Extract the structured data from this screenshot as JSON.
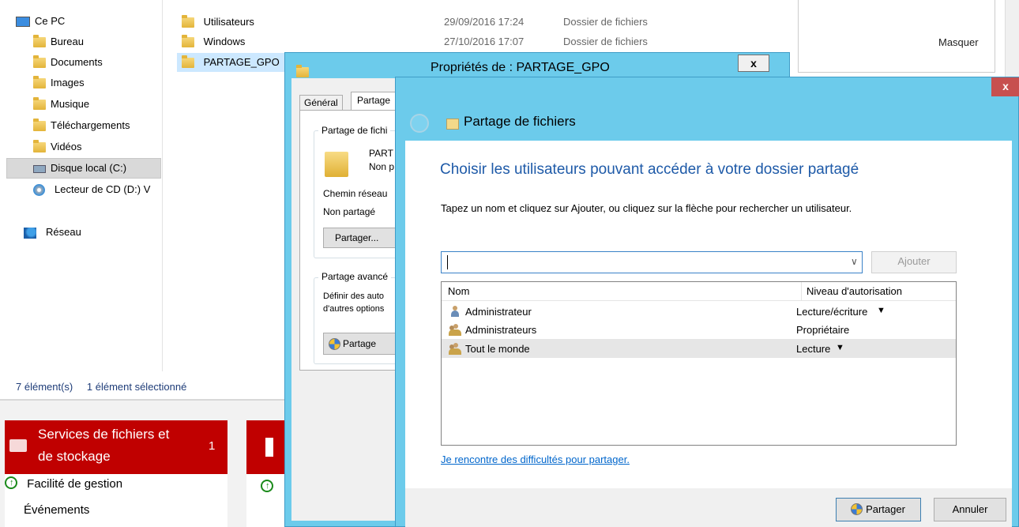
{
  "explorer": {
    "nav": [
      {
        "label": "Ce PC",
        "icon": "computer-icon"
      },
      {
        "label": "Bureau",
        "icon": "folder-icon"
      },
      {
        "label": "Documents",
        "icon": "folder-icon"
      },
      {
        "label": "Images",
        "icon": "folder-icon"
      },
      {
        "label": "Musique",
        "icon": "folder-icon"
      },
      {
        "label": "Téléchargements",
        "icon": "folder-icon"
      },
      {
        "label": "Vidéos",
        "icon": "folder-icon"
      },
      {
        "label": "Disque local (C:)",
        "icon": "drive-icon"
      },
      {
        "label": "Lecteur de CD (D:) V",
        "icon": "cd-drive-icon"
      },
      {
        "label": "Réseau",
        "icon": "network-icon"
      }
    ],
    "files": [
      {
        "name": "Utilisateurs",
        "date": "29/09/2016 17:24",
        "type": "Dossier de fichiers"
      },
      {
        "name": "Windows",
        "date": "27/10/2016 17:07",
        "type": "Dossier de fichiers"
      },
      {
        "name": "PARTAGE_GPO",
        "date": "",
        "type": ""
      }
    ],
    "status_count": "7 élément(s)",
    "status_selected": "1 élément sélectionné",
    "hide_label": "Masquer"
  },
  "server_manager": {
    "tile_title_line1": "Services de fichiers et",
    "tile_title_line2": "de stockage",
    "tile_count": "1",
    "item1": "Facilité de gestion",
    "item2": "Événements"
  },
  "properties": {
    "title": "Propriétés de : PARTAGE_GPO",
    "close": "x",
    "tab_general": "Général",
    "tab_share": "Partage",
    "group1": "Partage de fichi",
    "folder_name": "PART",
    "folder_state": "Non p",
    "net_path": "Chemin réseau",
    "net_value": "Non partagé",
    "share_button": "Partager...",
    "group2": "Partage avancé",
    "adv_text1": "Définir des auto",
    "adv_text2": "d'autres options",
    "adv_button": "Partage"
  },
  "share_wizard": {
    "close": "x",
    "title": "Partage de fichiers",
    "heading": "Choisir les utilisateurs pouvant accéder à votre dossier partagé",
    "instruction": "Tapez un nom et cliquez sur Ajouter, ou cliquez sur la flèche pour rechercher un utilisateur.",
    "input_value": "",
    "add_button": "Ajouter",
    "col_name": "Nom",
    "col_level": "Niveau d'autorisation",
    "rows": [
      {
        "name": "Administrateur",
        "level": "Lecture/écriture",
        "dropdown": true,
        "icon": "user-icon"
      },
      {
        "name": "Administrateurs",
        "level": "Propriétaire",
        "dropdown": false,
        "icon": "group-icon"
      },
      {
        "name": "Tout le monde",
        "level": "Lecture",
        "dropdown": true,
        "icon": "group-icon"
      }
    ],
    "help_link": "Je rencontre des difficultés pour partager.",
    "share_button": "Partager",
    "cancel_button": "Annuler"
  },
  "colors": {
    "accent": "#6ccbeb",
    "tile_red": "#c00000",
    "link": "#0066cc",
    "heading": "#1e5aa8"
  }
}
